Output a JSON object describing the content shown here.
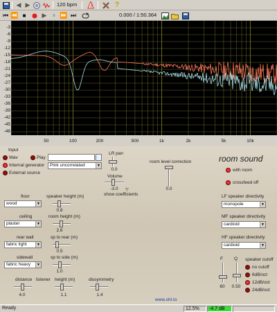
{
  "toolbar1": {
    "bpm": "120 bpm",
    "icons": [
      "floppy-icon",
      "back-icon",
      "forward-icon",
      "cd-icon",
      "waveform-icon",
      "metronome-icon",
      "tools-icon",
      "help-icon"
    ]
  },
  "toolbar2": {
    "time": "0.000 / 1:50.364"
  },
  "plot": {
    "y_ticks": [
      "-3",
      "-6",
      "-9",
      "-12",
      "-15",
      "-18",
      "-21",
      "-24",
      "-27",
      "-30",
      "-33",
      "-36",
      "-39",
      "-42",
      "-45",
      "-48"
    ],
    "x_ticks": [
      "50",
      "100",
      "200",
      "500",
      "1k",
      "2k",
      "5k",
      "10k"
    ],
    "colors": {
      "bg": "#000000",
      "grid": "#6b6b2a",
      "series_a": "#ff7a5a",
      "series_b": "#a8e0e8"
    }
  },
  "input": {
    "header": "Input",
    "wav": "Wav",
    "play": "Play",
    "internal": "Internal generator",
    "external": "External source",
    "generator_value": "Pink uncorrelated"
  },
  "lr_pan": {
    "label": "LR pan",
    "value": "0.0"
  },
  "volume": {
    "label": "Volume",
    "value": "-3.0"
  },
  "show_coeff": "show coefficients",
  "room_level": {
    "label": "room level correction",
    "value": "0.0"
  },
  "room_sound": {
    "title": "room sound",
    "with_room": "with room",
    "crossfeed": "crossfeed off"
  },
  "floor": {
    "label": "floor",
    "value": "wood"
  },
  "speaker_height": {
    "label": "speaker height (m)",
    "value": "0.8"
  },
  "ceiling": {
    "label": "ceiling",
    "value": "plaster"
  },
  "room_height": {
    "label": "room height (m)",
    "value": "2.6"
  },
  "rear_wall": {
    "label": "rear wall",
    "value": "fabric light"
  },
  "sp_rear": {
    "label": "sp to rear (m)",
    "value": "0.5"
  },
  "sidewall": {
    "label": "sidewall",
    "value": "fabric heavy"
  },
  "sp_side": {
    "label": "sp to side (m)",
    "value": "1.0"
  },
  "distance": {
    "label": "distance",
    "value": "4.0"
  },
  "listener_height": {
    "label": "listener",
    "label2": "height (m)",
    "value": "1.1"
  },
  "dissymmetry": {
    "label": "dissymmetry",
    "value": "1.4"
  },
  "lf": {
    "label": "LF speaker directivity",
    "value": "monopole"
  },
  "mf": {
    "label": "MF speaker directivity",
    "value": "cardioid"
  },
  "hf": {
    "label": "HF speaker directivity",
    "value": "cardioid"
  },
  "filter": {
    "f_label": "F",
    "q_label": "Q",
    "f_value": "60",
    "q_value": "0.50"
  },
  "cutoff": {
    "label": "speaker cutoff",
    "options": [
      "no cutoff",
      "6dB/oct",
      "12dB/oct",
      "24dB/oct"
    ],
    "selected": 2
  },
  "url": "www.ohl.to",
  "status": {
    "ready": "Ready",
    "percent": "12.5%",
    "db": "-4.7 dB"
  }
}
